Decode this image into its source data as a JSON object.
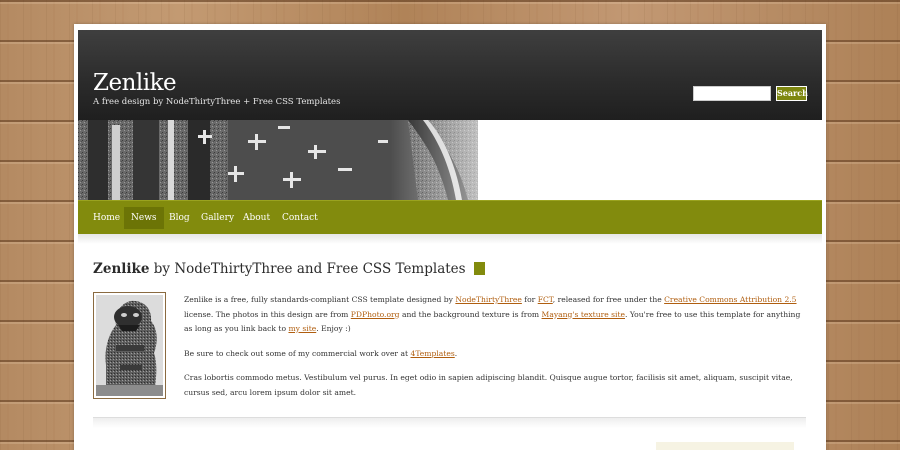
{
  "header": {
    "title": "Zenlike",
    "tagline": "A free design by NodeThirtyThree + Free CSS Templates"
  },
  "search": {
    "value": "",
    "button_label": "Search"
  },
  "nav": {
    "items": [
      {
        "label": "Home",
        "active": false
      },
      {
        "label": "News",
        "active": true
      },
      {
        "label": "Blog",
        "active": false
      },
      {
        "label": "Gallery",
        "active": false
      },
      {
        "label": "About",
        "active": false
      },
      {
        "label": "Contact",
        "active": false
      }
    ]
  },
  "post": {
    "title_bold": "Zenlike",
    "title_rest": " by NodeThirtyThree and Free CSS Templates",
    "p1": {
      "t1": "Zenlike is a free, fully standards-compliant CSS template designed by ",
      "link1": "NodeThirtyThree",
      "t2": " for ",
      "link2": "FCT",
      "t3": ", released for free under the ",
      "link3": "Creative Commons Attribution 2.5",
      "t4": " license. The photos in this design are from ",
      "link4": "PDPhoto.org",
      "t5": " and the background texture is from ",
      "link5": "Mayang's texture site",
      "t6": ". You're free to use this template for anything as long as you link back to ",
      "link6": "my site",
      "t7": ". Enjoy :)"
    },
    "p2": {
      "t1": "Be sure to check out some of my commercial work over at ",
      "link1": "4Templates",
      "t2": "."
    },
    "p3": "Cras lobortis commodo metus. Vestibulum vel purus. In eget odio in sapien adipiscing blandit. Quisque augue tortor, facilisis sit amet, aliquam, suscipit vitae, cursus sed, arcu lorem ipsum dolor sit amet."
  },
  "colors": {
    "accent": "#828b0d",
    "link": "#b05e0f",
    "header_bg": "#2c2c2c"
  }
}
